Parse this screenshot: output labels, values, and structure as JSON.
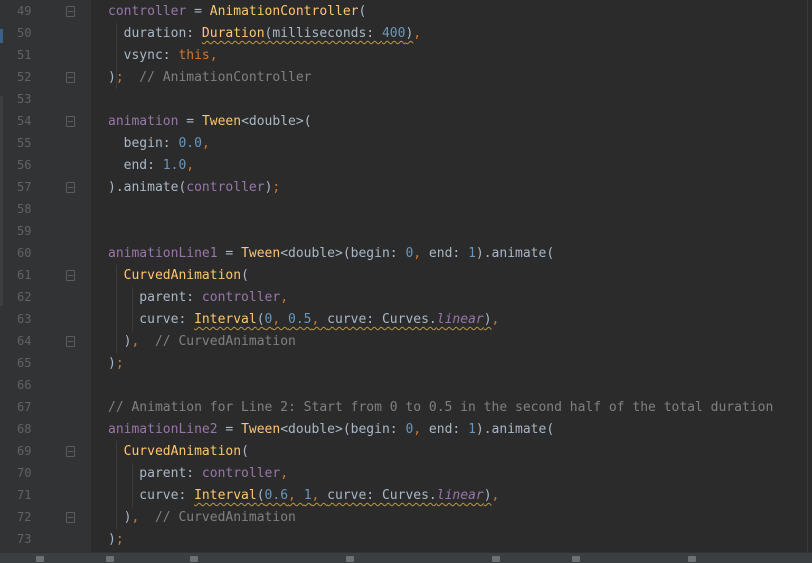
{
  "editor": {
    "theme_colors": {
      "background": "#2b2b2b",
      "gutter": "#313335",
      "line_number": "#606366",
      "field": "#9876aa",
      "class_name": "#ffc66d",
      "keyword": "#cc7832",
      "number": "#6897bb",
      "comment": "#808080",
      "plain": "#a9b7c6"
    },
    "lines": [
      {
        "number": "49",
        "fold": true,
        "tokens": [
          [
            "t-var",
            "controller"
          ],
          [
            "t-op",
            " = "
          ],
          [
            "t-cls",
            "AnimationController"
          ],
          [
            "t-op",
            "("
          ]
        ]
      },
      {
        "number": "50",
        "fold": false,
        "tokens": [
          [
            "t-pl",
            "  duration: "
          ],
          [
            "t-cls t-warn",
            "Duration"
          ],
          [
            "t-pl t-warn",
            "(milliseconds: "
          ],
          [
            "t-num t-warn",
            "400"
          ],
          [
            "t-pl t-warn",
            ")"
          ],
          [
            "t-kw",
            ","
          ]
        ]
      },
      {
        "number": "51",
        "fold": false,
        "tokens": [
          [
            "t-pl",
            "  vsync: "
          ],
          [
            "t-kw",
            "this"
          ],
          [
            "t-kw",
            ","
          ]
        ]
      },
      {
        "number": "52",
        "fold": true,
        "tokens": [
          [
            "t-pl",
            ")"
          ],
          [
            "t-kw",
            ";"
          ],
          [
            "t-cmt",
            "  // AnimationController"
          ]
        ]
      },
      {
        "number": "53",
        "fold": false,
        "tokens": []
      },
      {
        "number": "54",
        "fold": true,
        "tokens": [
          [
            "t-var",
            "animation"
          ],
          [
            "t-op",
            " = "
          ],
          [
            "t-cls",
            "Tween"
          ],
          [
            "t-pl",
            "<double>("
          ]
        ]
      },
      {
        "number": "55",
        "fold": false,
        "tokens": [
          [
            "t-pl",
            "  begin: "
          ],
          [
            "t-num",
            "0.0"
          ],
          [
            "t-kw",
            ","
          ]
        ]
      },
      {
        "number": "56",
        "fold": false,
        "tokens": [
          [
            "t-pl",
            "  end: "
          ],
          [
            "t-num",
            "1.0"
          ],
          [
            "t-kw",
            ","
          ]
        ]
      },
      {
        "number": "57",
        "fold": true,
        "tokens": [
          [
            "t-pl",
            ").animate("
          ],
          [
            "t-var",
            "controller"
          ],
          [
            "t-pl",
            ")"
          ],
          [
            "t-kw",
            ";"
          ]
        ]
      },
      {
        "number": "58",
        "fold": false,
        "tokens": []
      },
      {
        "number": "59",
        "fold": false,
        "tokens": []
      },
      {
        "number": "60",
        "fold": false,
        "tokens": [
          [
            "t-var",
            "animationLine1"
          ],
          [
            "t-op",
            " = "
          ],
          [
            "t-cls",
            "Tween"
          ],
          [
            "t-pl",
            "<double>(begin: "
          ],
          [
            "t-num",
            "0"
          ],
          [
            "t-kw",
            ", "
          ],
          [
            "t-pl",
            "end: "
          ],
          [
            "t-num",
            "1"
          ],
          [
            "t-pl",
            ").animate("
          ]
        ]
      },
      {
        "number": "61",
        "fold": true,
        "tokens": [
          [
            "t-pl",
            "  "
          ],
          [
            "t-cls",
            "CurvedAnimation"
          ],
          [
            "t-pl",
            "("
          ]
        ]
      },
      {
        "number": "62",
        "fold": false,
        "tokens": [
          [
            "t-pl",
            "    parent: "
          ],
          [
            "t-var",
            "controller"
          ],
          [
            "t-kw",
            ","
          ]
        ]
      },
      {
        "number": "63",
        "fold": false,
        "tokens": [
          [
            "t-pl",
            "    curve: "
          ],
          [
            "t-cls t-warn",
            "Interval"
          ],
          [
            "t-pl t-warn",
            "("
          ],
          [
            "t-num t-warn",
            "0"
          ],
          [
            "t-kw t-warn",
            ", "
          ],
          [
            "t-num t-warn",
            "0.5"
          ],
          [
            "t-kw t-warn",
            ", "
          ],
          [
            "t-pl t-warn",
            "curve: Curves."
          ],
          [
            "t-it t-warn",
            "linear"
          ],
          [
            "t-pl t-warn",
            ")"
          ],
          [
            "t-kw",
            ","
          ]
        ]
      },
      {
        "number": "64",
        "fold": true,
        "tokens": [
          [
            "t-pl",
            "  )"
          ],
          [
            "t-kw",
            ","
          ],
          [
            "t-cmt",
            "  // CurvedAnimation"
          ]
        ]
      },
      {
        "number": "65",
        "fold": false,
        "tokens": [
          [
            "t-pl",
            ")"
          ],
          [
            "t-kw",
            ";"
          ]
        ]
      },
      {
        "number": "66",
        "fold": false,
        "tokens": []
      },
      {
        "number": "67",
        "fold": false,
        "tokens": [
          [
            "t-cmt",
            "// Animation for Line 2: Start from 0 to 0.5 in the second half of the total duration"
          ]
        ]
      },
      {
        "number": "68",
        "fold": false,
        "tokens": [
          [
            "t-var",
            "animationLine2"
          ],
          [
            "t-op",
            " = "
          ],
          [
            "t-cls",
            "Tween"
          ],
          [
            "t-pl",
            "<double>(begin: "
          ],
          [
            "t-num",
            "0"
          ],
          [
            "t-kw",
            ", "
          ],
          [
            "t-pl",
            "end: "
          ],
          [
            "t-num",
            "1"
          ],
          [
            "t-pl",
            ").animate("
          ]
        ]
      },
      {
        "number": "69",
        "fold": true,
        "tokens": [
          [
            "t-pl",
            "  "
          ],
          [
            "t-cls",
            "CurvedAnimation"
          ],
          [
            "t-pl",
            "("
          ]
        ]
      },
      {
        "number": "70",
        "fold": false,
        "tokens": [
          [
            "t-pl",
            "    parent: "
          ],
          [
            "t-var",
            "controller"
          ],
          [
            "t-kw",
            ","
          ]
        ]
      },
      {
        "number": "71",
        "fold": false,
        "tokens": [
          [
            "t-pl",
            "    curve: "
          ],
          [
            "t-cls t-warn",
            "Interval"
          ],
          [
            "t-pl t-warn",
            "("
          ],
          [
            "t-num t-warn",
            "0.6"
          ],
          [
            "t-kw t-warn",
            ", "
          ],
          [
            "t-num t-warn",
            "1"
          ],
          [
            "t-kw t-warn",
            ", "
          ],
          [
            "t-pl t-warn",
            "curve: Curves."
          ],
          [
            "t-it t-warn",
            "linear"
          ],
          [
            "t-pl t-warn",
            ")"
          ],
          [
            "t-kw",
            ","
          ]
        ]
      },
      {
        "number": "72",
        "fold": true,
        "tokens": [
          [
            "t-pl",
            "  )"
          ],
          [
            "t-kw",
            ","
          ],
          [
            "t-cmt",
            "  // CurvedAnimation"
          ]
        ]
      },
      {
        "number": "73",
        "fold": false,
        "tokens": [
          [
            "t-pl",
            ")"
          ],
          [
            "t-kw",
            ";"
          ]
        ]
      }
    ]
  }
}
